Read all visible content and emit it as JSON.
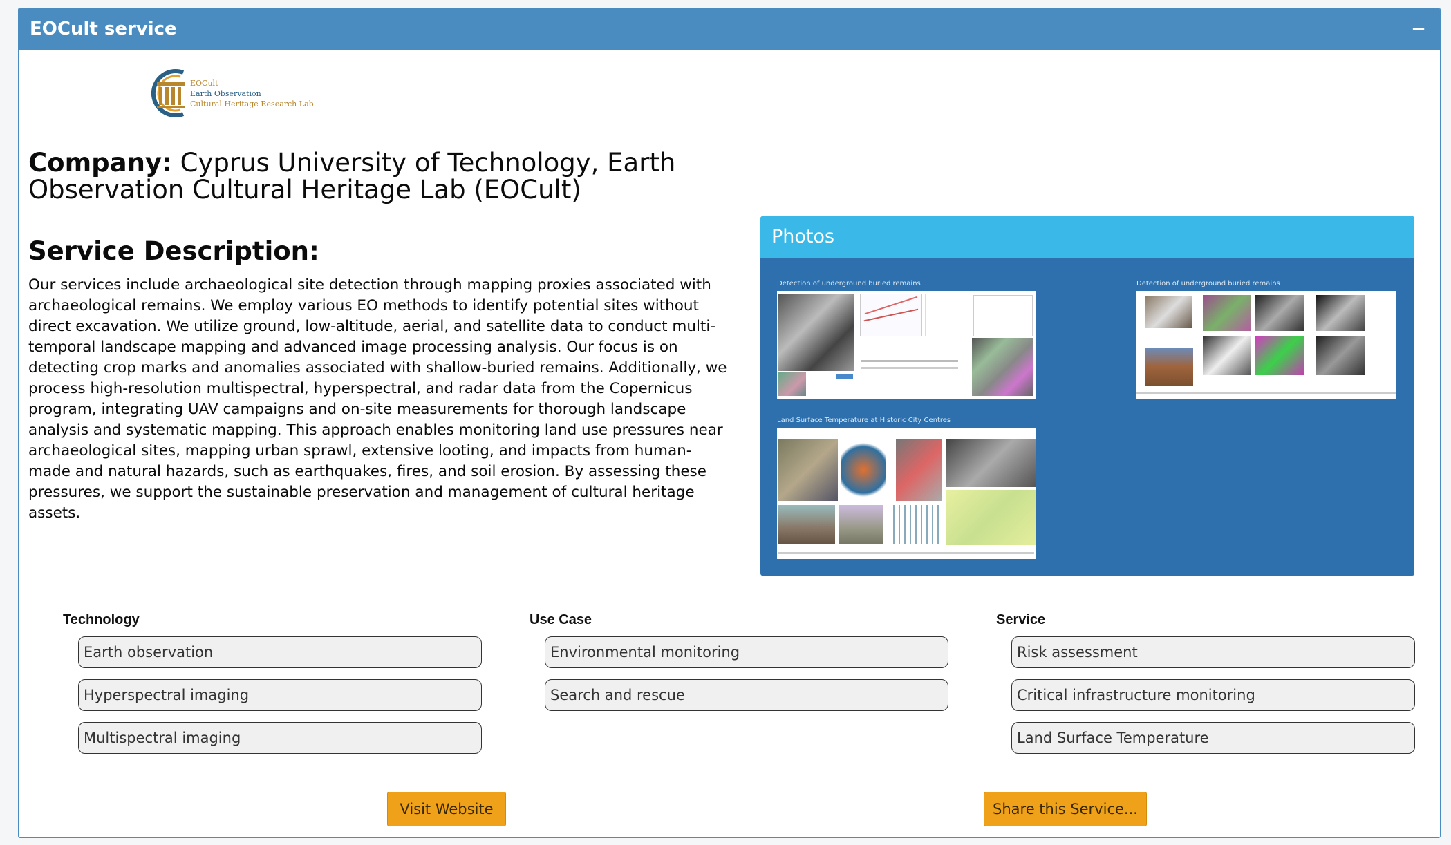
{
  "header": {
    "title": "EOCult service",
    "collapse_icon": "−"
  },
  "logo": {
    "line1": "EOCult",
    "line2": "Earth Observation",
    "line3": "Cultural Heritage Research Lab"
  },
  "company": {
    "label": "Company:",
    "name": "Cyprus University of Technology, Earth Observation Cultural Heritage Lab (EOCult)"
  },
  "description": {
    "title": "Service Description:",
    "text": "Our services include archaeological site detection through mapping proxies associated with archaeological remains. We employ various EO methods to identify potential sites without direct excavation. We utilize ground, low-altitude, aerial, and satellite data to conduct multi-temporal landscape mapping and advanced image processing analysis. Our focus is on detecting crop marks and anomalies associated with shallow-buried remains. Additionally, we process high-resolution multispectral, hyperspectral, and radar data from the Copernicus program, integrating UAV campaigns and on-site measurements for thorough landscape analysis and systematic mapping. This approach enables monitoring land use pressures near archaeological sites, mapping urban sprawl, extensive looting, and impacts from human-made and natural hazards, such as earthquakes, fires, and soil erosion. By assessing these pressures, we support the sustainable preservation and management of cultural heritage assets."
  },
  "photos": {
    "title": "Photos",
    "items": [
      {
        "caption": "Detection of underground  buried remains"
      },
      {
        "caption": "Detection of underground  buried remains"
      },
      {
        "caption": "Land Surface Temperature at Historic City Centres"
      }
    ]
  },
  "technology": {
    "title": "Technology",
    "tags": [
      "Earth observation",
      "Hyperspectral imaging",
      "Multispectral imaging"
    ]
  },
  "use_case": {
    "title": "Use Case",
    "tags": [
      "Environmental monitoring",
      "Search and rescue"
    ]
  },
  "service": {
    "title": "Service",
    "tags": [
      "Risk assessment",
      "Critical infrastructure monitoring",
      "Land Surface Temperature"
    ]
  },
  "buttons": {
    "visit": "Visit Website",
    "share": "Share this Service..."
  },
  "colors": {
    "header": "#4a8cc0",
    "photos_header": "#3ab9e9",
    "photos_body": "#2d70ad",
    "button": "#f0a11a"
  }
}
